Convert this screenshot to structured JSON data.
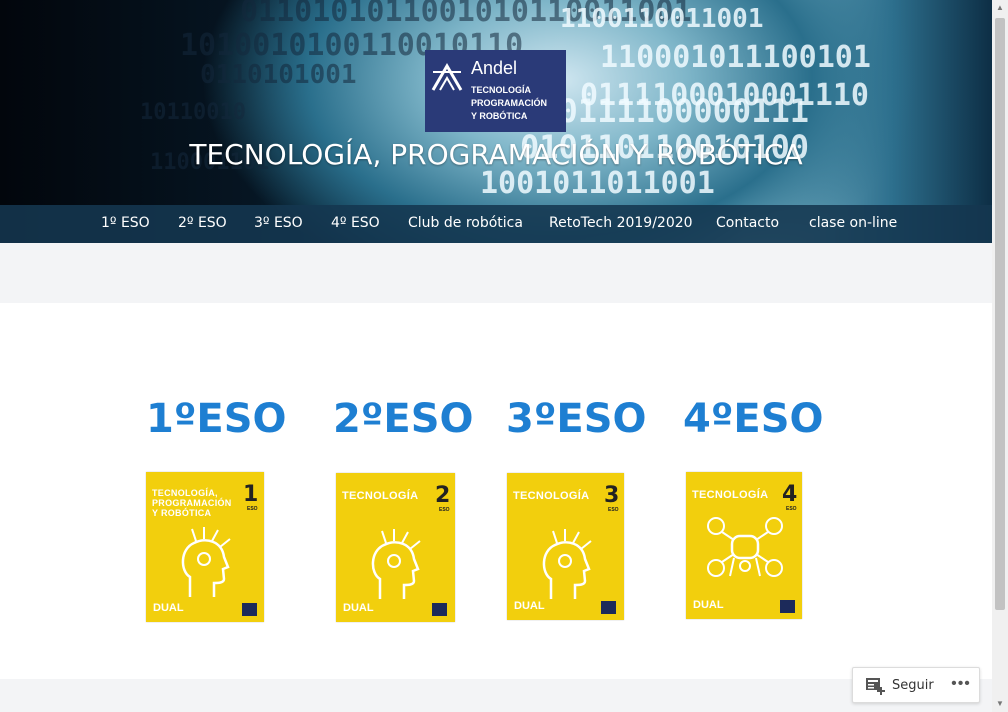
{
  "header": {
    "logo": {
      "name": "Andel",
      "lines": [
        "TECNOLOGÍA",
        "PROGRAMACIÓN",
        "Y ROBÓTICA"
      ]
    },
    "site_title": "TECNOLOGÍA, PROGRAMACIÓN Y ROBÓTICA"
  },
  "nav": {
    "items": [
      {
        "label": "1º ESO"
      },
      {
        "label": "2º ESO"
      },
      {
        "label": "3º ESO"
      },
      {
        "label": "4º ESO"
      },
      {
        "label": "Club de robótica"
      },
      {
        "label": "RetoTech 2019/2020"
      },
      {
        "label": "Contacto"
      },
      {
        "label": "clase on-line"
      }
    ]
  },
  "grades": [
    {
      "heading": "1ºESO",
      "book": {
        "title_lines": [
          "TECNOLOGÍA,",
          "PROGRAMACIÓN",
          "Y ROBÓTICA"
        ],
        "number": "1",
        "level": "ESO",
        "edition": "DUAL",
        "art": "head-icon"
      }
    },
    {
      "heading": "2ºESO",
      "book": {
        "title_lines": [
          "TECNOLOGÍA"
        ],
        "number": "2",
        "level": "ESO",
        "edition": "DUAL",
        "art": "head-icon"
      }
    },
    {
      "heading": "3ºESO",
      "book": {
        "title_lines": [
          "TECNOLOGÍA"
        ],
        "number": "3",
        "level": "ESO",
        "edition": "DUAL",
        "art": "head-icon"
      }
    },
    {
      "heading": "4ºESO",
      "book": {
        "title_lines": [
          "TECNOLOGÍA"
        ],
        "number": "4",
        "level": "ESO",
        "edition": "DUAL",
        "art": "drone-icon"
      }
    }
  ],
  "follow": {
    "label": "Seguir",
    "more": "•••"
  },
  "colors": {
    "heading_blue": "#1e7fd2",
    "book_yellow": "#f2cf0d",
    "logo_blue": "#2a3a78",
    "nav_bar": "#14374f"
  }
}
